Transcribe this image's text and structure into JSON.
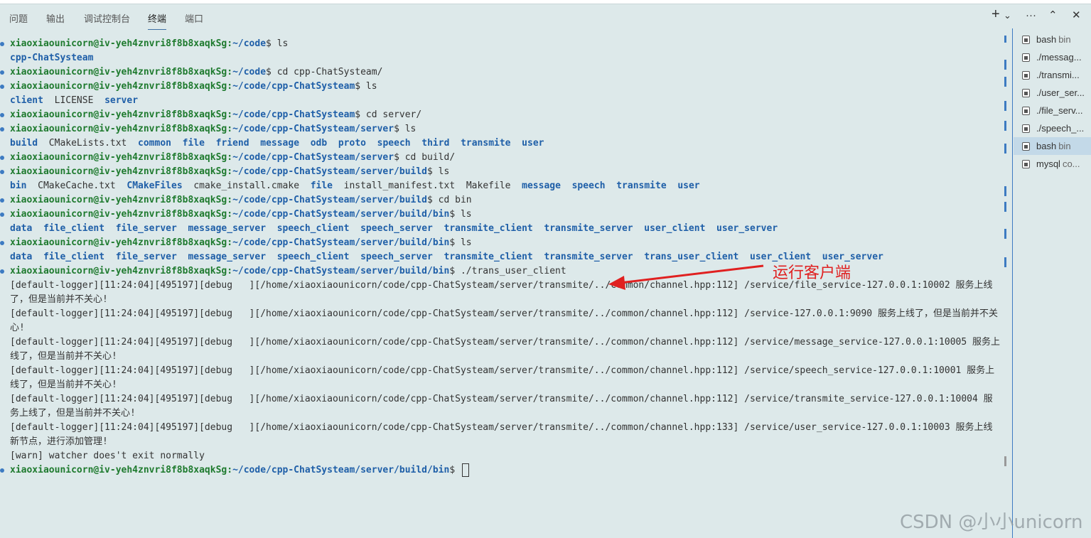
{
  "tabs": [
    "问题",
    "输出",
    "调试控制台",
    "终端",
    "端口"
  ],
  "active_tab": "终端",
  "panel_actions": {
    "add": "+",
    "dropdown": "⌄",
    "more": "···",
    "collapse": "⌃",
    "close": "✕"
  },
  "prompt_user": "xiaoxiaounicorn@iv-yeh4znvri8f8b8xaqkSg",
  "terminal": [
    {
      "kind": "prompt",
      "path": "~/code",
      "cmd": " ls"
    },
    {
      "kind": "out",
      "items": [
        [
          "cpp-ChatSysteam",
          "d"
        ]
      ]
    },
    {
      "kind": "prompt",
      "path": "~/code",
      "cmd": " cd cpp-ChatSysteam/"
    },
    {
      "kind": "prompt",
      "path": "~/code/cpp-ChatSysteam",
      "cmd": " ls"
    },
    {
      "kind": "out",
      "items": [
        [
          "client",
          "d"
        ],
        [
          "LICENSE",
          "f"
        ],
        [
          "server",
          "d"
        ]
      ]
    },
    {
      "kind": "prompt",
      "path": "~/code/cpp-ChatSysteam",
      "cmd": " cd server/"
    },
    {
      "kind": "prompt",
      "path": "~/code/cpp-ChatSysteam/server",
      "cmd": " ls"
    },
    {
      "kind": "out",
      "items": [
        [
          "build",
          "d"
        ],
        [
          "CMakeLists.txt",
          "f"
        ],
        [
          "common",
          "d"
        ],
        [
          "file",
          "d"
        ],
        [
          "friend",
          "d"
        ],
        [
          "message",
          "d"
        ],
        [
          "odb",
          "d"
        ],
        [
          "proto",
          "d"
        ],
        [
          "speech",
          "d"
        ],
        [
          "third",
          "d"
        ],
        [
          "transmite",
          "d"
        ],
        [
          "user",
          "d"
        ]
      ]
    },
    {
      "kind": "prompt",
      "path": "~/code/cpp-ChatSysteam/server",
      "cmd": " cd build/"
    },
    {
      "kind": "prompt",
      "path": "~/code/cpp-ChatSysteam/server/build",
      "cmd": " ls"
    },
    {
      "kind": "out",
      "items": [
        [
          "bin",
          "d"
        ],
        [
          "CMakeCache.txt",
          "f"
        ],
        [
          "CMakeFiles",
          "d"
        ],
        [
          "cmake_install.cmake",
          "f"
        ],
        [
          "file",
          "d"
        ],
        [
          "install_manifest.txt",
          "f"
        ],
        [
          "Makefile",
          "f"
        ],
        [
          "message",
          "d"
        ],
        [
          "speech",
          "d"
        ],
        [
          "transmite",
          "d"
        ],
        [
          "user",
          "d"
        ]
      ]
    },
    {
      "kind": "prompt",
      "path": "~/code/cpp-ChatSysteam/server/build",
      "cmd": " cd bin"
    },
    {
      "kind": "prompt",
      "path": "~/code/cpp-ChatSysteam/server/build/bin",
      "cmd": " ls"
    },
    {
      "kind": "out",
      "items": [
        [
          "data",
          "d"
        ],
        [
          "file_client",
          "d"
        ],
        [
          "file_server",
          "d"
        ],
        [
          "message_server",
          "d"
        ],
        [
          "speech_client",
          "d"
        ],
        [
          "speech_server",
          "d"
        ],
        [
          "transmite_client",
          "d"
        ],
        [
          "transmite_server",
          "d"
        ],
        [
          "user_client",
          "d"
        ],
        [
          "user_server",
          "d"
        ]
      ]
    },
    {
      "kind": "prompt",
      "path": "~/code/cpp-ChatSysteam/server/build/bin",
      "cmd": " ls"
    },
    {
      "kind": "out",
      "items": [
        [
          "data",
          "d"
        ],
        [
          "file_client",
          "d"
        ],
        [
          "file_server",
          "d"
        ],
        [
          "message_server",
          "d"
        ],
        [
          "speech_client",
          "d"
        ],
        [
          "speech_server",
          "d"
        ],
        [
          "transmite_client",
          "d"
        ],
        [
          "transmite_server",
          "d"
        ],
        [
          "trans_user_client",
          "d"
        ],
        [
          "user_client",
          "d"
        ],
        [
          "user_server",
          "d"
        ]
      ]
    },
    {
      "kind": "prompt",
      "path": "~/code/cpp-ChatSysteam/server/build/bin",
      "cmd": " ./trans_user_client"
    },
    {
      "kind": "log",
      "text": "[default-logger][11:24:04][495197][debug   ][/home/xiaoxiaounicorn/code/cpp-ChatSysteam/server/transmite/../common/channel.hpp:112] /service/file_service-127.0.0.1:10002 服务上线了，但是当前并不关心!"
    },
    {
      "kind": "log",
      "text": "[default-logger][11:24:04][495197][debug   ][/home/xiaoxiaounicorn/code/cpp-ChatSysteam/server/transmite/../common/channel.hpp:112] /service-127.0.0.1:9090 服务上线了，但是当前并不关心!"
    },
    {
      "kind": "log",
      "text": "[default-logger][11:24:04][495197][debug   ][/home/xiaoxiaounicorn/code/cpp-ChatSysteam/server/transmite/../common/channel.hpp:112] /service/message_service-127.0.0.1:10005 服务上线了，但是当前并不关心!"
    },
    {
      "kind": "log",
      "text": "[default-logger][11:24:04][495197][debug   ][/home/xiaoxiaounicorn/code/cpp-ChatSysteam/server/transmite/../common/channel.hpp:112] /service/speech_service-127.0.0.1:10001 服务上线了，但是当前并不关心!"
    },
    {
      "kind": "log",
      "text": "[default-logger][11:24:04][495197][debug   ][/home/xiaoxiaounicorn/code/cpp-ChatSysteam/server/transmite/../common/channel.hpp:112] /service/transmite_service-127.0.0.1:10004 服务上线了，但是当前并不关心!"
    },
    {
      "kind": "log",
      "text": "[default-logger][11:24:04][495197][debug   ][/home/xiaoxiaounicorn/code/cpp-ChatSysteam/server/transmite/../common/channel.hpp:133] /service/user_service-127.0.0.1:10003 服务上线新节点，进行添加管理!"
    },
    {
      "kind": "log",
      "text": "[warn] watcher does't exit normally"
    },
    {
      "kind": "prompt",
      "path": "~/code/cpp-ChatSysteam/server/build/bin",
      "cmd": " ",
      "cursor": true
    }
  ],
  "sidebar": [
    {
      "label": "bash",
      "sub": "bin",
      "active": false
    },
    {
      "label": "./messag...",
      "sub": "",
      "active": false
    },
    {
      "label": "./transmi...",
      "sub": "",
      "active": false
    },
    {
      "label": "./user_ser...",
      "sub": "",
      "active": false
    },
    {
      "label": "./file_serv...",
      "sub": "",
      "active": false
    },
    {
      "label": "./speech_...",
      "sub": "",
      "active": false
    },
    {
      "label": "bash",
      "sub": "bin",
      "active": true
    },
    {
      "label": "mysql",
      "sub": "co...",
      "active": false
    }
  ],
  "annotation": "运行客户端",
  "watermark": "CSDN @小小unicorn",
  "colors": {
    "background": "#dde9ea",
    "accent": "#3d7bc2",
    "annotation": "#e02020"
  }
}
